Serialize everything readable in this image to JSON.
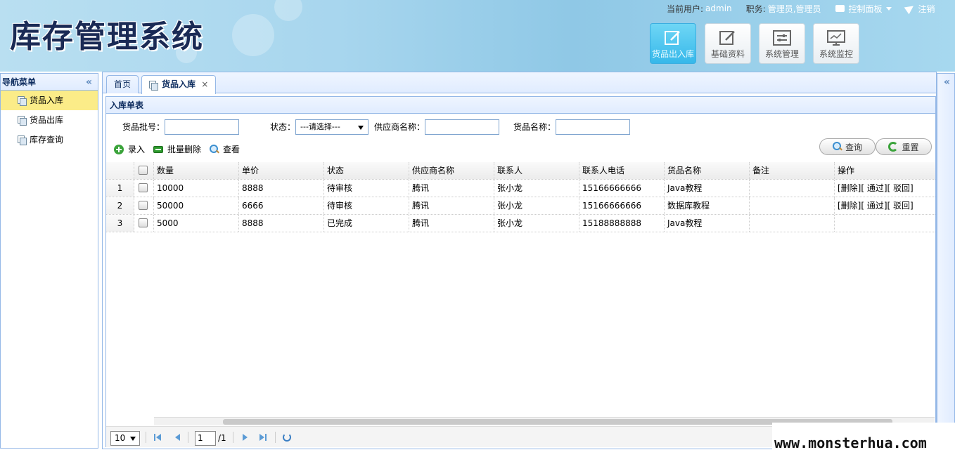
{
  "header": {
    "logo": "库存管理系统",
    "user_label": "当前用户:",
    "user_value": "admin",
    "role_label": "职务:",
    "role_value": "管理员,管理员",
    "control_panel": "控制面板",
    "logout": "注销",
    "modules": [
      {
        "label": "货品出入库",
        "icon": "edit-icon",
        "active": true
      },
      {
        "label": "基础资料",
        "icon": "edit-icon",
        "active": false
      },
      {
        "label": "系统管理",
        "icon": "settings-panel-icon",
        "active": false
      },
      {
        "label": "系统监控",
        "icon": "monitor-icon",
        "active": false
      }
    ]
  },
  "nav": {
    "title": "导航菜单",
    "items": [
      "货品入库",
      "货品出库",
      "库存查询"
    ],
    "selected": 0
  },
  "tabs": [
    {
      "label": "首页"
    },
    {
      "label": "货品入库",
      "close": "×"
    }
  ],
  "grid": {
    "title": "入库单表",
    "search": {
      "batch_label": "货品批号：",
      "status_label": "状态：",
      "status_value": "---请选择---",
      "supplier_label": "供应商名称：",
      "goods_label": "货品名称："
    },
    "actions": {
      "add": "录入",
      "batch_delete": "批量删除",
      "view": "查看",
      "query": "查询",
      "reset": "重置"
    },
    "columns": [
      "数量",
      "单价",
      "状态",
      "供应商名称",
      "联系人",
      "联系人电话",
      "货品名称",
      "备注",
      "操作"
    ],
    "rows": [
      {
        "num": "1",
        "cells": [
          "10000",
          "8888",
          "待审核",
          "腾讯",
          "张小龙",
          "15166666666",
          "Java教程",
          "",
          "[删除][ 通过][ 驳回]"
        ]
      },
      {
        "num": "2",
        "cells": [
          "50000",
          "6666",
          "待审核",
          "腾讯",
          "张小龙",
          "15166666666",
          "数据库教程",
          "",
          "[删除][ 通过][ 驳回]"
        ]
      },
      {
        "num": "3",
        "cells": [
          "5000",
          "8888",
          "已完成",
          "腾讯",
          "张小龙",
          "15188888888",
          "Java教程",
          "",
          ""
        ]
      }
    ],
    "pager": {
      "page_size": "10",
      "page": "1",
      "total": "/1"
    }
  },
  "watermark": "www.monsterhua.com",
  "colors": {
    "panel_border": "#95b8e7",
    "selected_menu": "#fbec88",
    "active_module": "#37b8ea"
  }
}
